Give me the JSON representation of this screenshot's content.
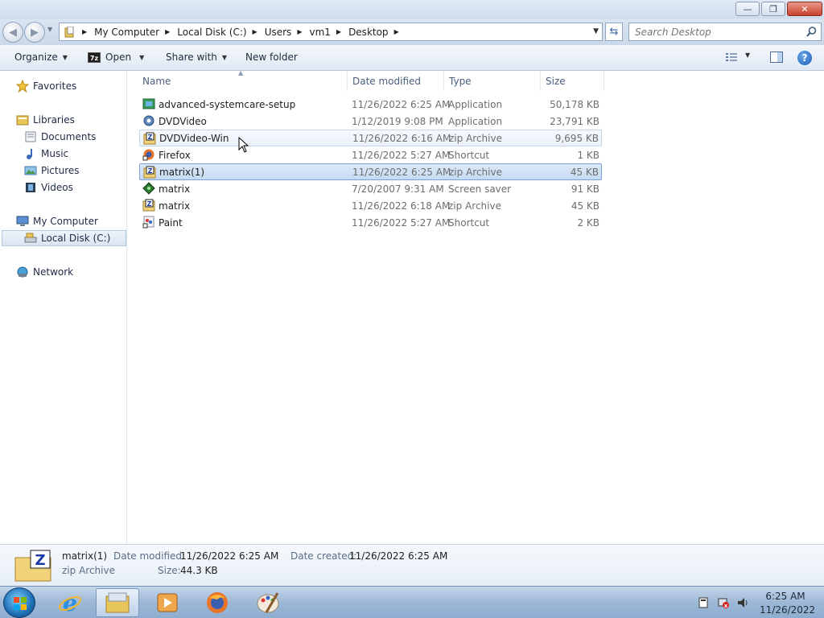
{
  "window": {
    "minimize": "—",
    "maximize": "❐",
    "close": "✕"
  },
  "address": {
    "crumbs": [
      "My Computer",
      "Local Disk (C:)",
      "Users",
      "vm1",
      "Desktop"
    ],
    "search_placeholder": "Search Desktop"
  },
  "toolbar": {
    "organize": "Organize",
    "open": "Open",
    "share_with": "Share with",
    "new_folder": "New folder",
    "zip_badge": "7z"
  },
  "sidebar": {
    "favorites": "Favorites",
    "libraries": "Libraries",
    "documents": "Documents",
    "music": "Music",
    "pictures": "Pictures",
    "videos": "Videos",
    "my_computer": "My Computer",
    "local_disk": "Local Disk (C:)",
    "network": "Network"
  },
  "columns": {
    "name": "Name",
    "date": "Date modified",
    "type": "Type",
    "size": "Size"
  },
  "files": [
    {
      "name": "advanced-systemcare-setup",
      "date": "11/26/2022 6:25 AM",
      "type": "Application",
      "size": "50,178 KB",
      "icon": "installer-icon"
    },
    {
      "name": "DVDVideo",
      "date": "1/12/2019 9:08 PM",
      "type": "Application",
      "size": "23,791 KB",
      "icon": "gear-app-icon"
    },
    {
      "name": "DVDVideo-Win",
      "date": "11/26/2022 6:16 AM",
      "type": "zip Archive",
      "size": "9,695 KB",
      "icon": "zip-icon"
    },
    {
      "name": "Firefox",
      "date": "11/26/2022 5:27 AM",
      "type": "Shortcut",
      "size": "1 KB",
      "icon": "firefox-shortcut-icon"
    },
    {
      "name": "matrix(1)",
      "date": "11/26/2022 6:25 AM",
      "type": "zip Archive",
      "size": "45 KB",
      "icon": "zip-icon"
    },
    {
      "name": "matrix",
      "date": "7/20/2007 9:31 AM",
      "type": "Screen saver",
      "size": "91 KB",
      "icon": "screensaver-icon"
    },
    {
      "name": "matrix",
      "date": "11/26/2022 6:18 AM",
      "type": "zip Archive",
      "size": "45 KB",
      "icon": "zip-icon"
    },
    {
      "name": "Paint",
      "date": "11/26/2022 5:27 AM",
      "type": "Shortcut",
      "size": "2 KB",
      "icon": "paint-shortcut-icon"
    }
  ],
  "details": {
    "name": "matrix(1)",
    "type": "zip Archive",
    "date_modified_label": "Date modified:",
    "date_modified": "11/26/2022 6:25 AM",
    "date_created_label": "Date created:",
    "date_created": "11/26/2022 6:25 AM",
    "size_label": "Size:",
    "size": "44.3 KB"
  },
  "taskbar": {
    "time": "6:25 AM",
    "date": "11/26/2022"
  },
  "colors": {
    "selection": "#c5dbf3",
    "accent": "#1c5fb8"
  }
}
